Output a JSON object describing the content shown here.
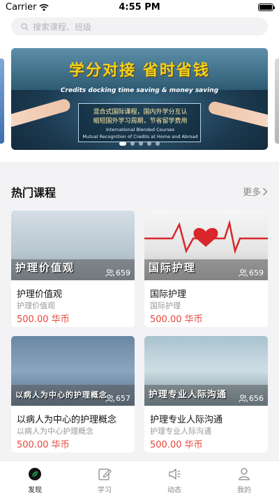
{
  "status": {
    "carrier": "Carrier",
    "time": "4:55 PM"
  },
  "search": {
    "placeholder": "搜索课程、班级"
  },
  "banner": {
    "title": "学分对接  省时省钱",
    "subtitle": "Credits docking time saving & money saving",
    "cn_line1": "混合式国际课程，国内外学分互认",
    "cn_line2": "缩短国外学习周期，节省留学费用",
    "en_line1": "International Blended Courses",
    "en_line2": "Mutual Recognition of Credits at Home and Abroad"
  },
  "section": {
    "title": "热门课程",
    "more_label": "更多"
  },
  "courses": [
    {
      "thumb_text": "护理价值观",
      "views": "659",
      "name": "护理价值观",
      "subtitle": "护理价值观",
      "price": "500.00 华币"
    },
    {
      "thumb_text": "国际护理",
      "views": "659",
      "name": "国际护理",
      "subtitle": "国际护理",
      "price": "500.00 华币"
    },
    {
      "thumb_text": "以病人为中心的护理概念",
      "views": "657",
      "name": "以病人为中心的护理概念",
      "subtitle": "以病人为中心护理概念",
      "price": "500.00 华币"
    },
    {
      "thumb_text": "护理专业人际沟通",
      "views": "656",
      "name": "护理专业人际沟通",
      "subtitle": "护理专业人际沟通",
      "price": "500.00 华币"
    }
  ],
  "tabs": [
    {
      "label": "发现",
      "icon": "compass-icon",
      "active": true
    },
    {
      "label": "学习",
      "icon": "edit-icon",
      "active": false
    },
    {
      "label": "动态",
      "icon": "speaker-icon",
      "active": false
    },
    {
      "label": "我的",
      "icon": "person-icon",
      "active": false
    }
  ],
  "colors": {
    "price": "#e8463b",
    "accent": "#1e9e55",
    "banner_title": "#f5d21c"
  }
}
